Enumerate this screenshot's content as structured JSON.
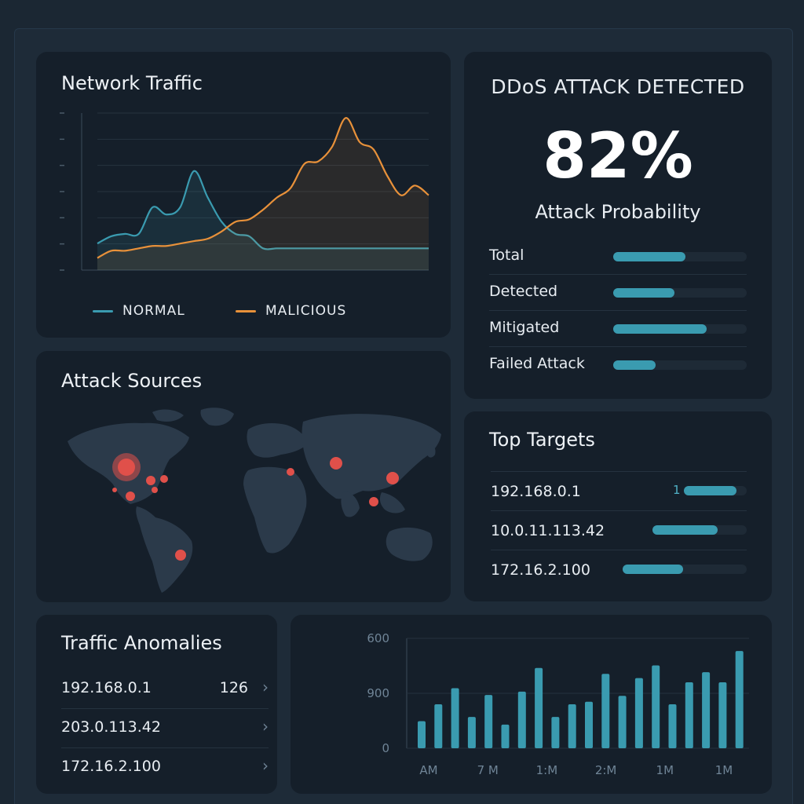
{
  "traffic": {
    "title": "Network Traffic",
    "legend": [
      {
        "label": "NORMAL",
        "color": "#3a9bb0"
      },
      {
        "label": "MALICIOUS",
        "color": "#e8913a"
      }
    ]
  },
  "ddos": {
    "title": "DDoS ATTACK DETECTED",
    "value": "82%",
    "subtitle": "Attack Probability",
    "stats": [
      {
        "label": "Total",
        "fraction": 0.54
      },
      {
        "label": "Detected",
        "fraction": 0.46
      },
      {
        "label": "Mitigated",
        "fraction": 0.7
      },
      {
        "label": "Failed Attack",
        "fraction": 0.32
      }
    ]
  },
  "sources": {
    "title": "Attack Sources"
  },
  "targets": {
    "title": "Top Targets",
    "rows": [
      {
        "label": "192.168.0.1",
        "count": "1",
        "fraction": 0.84
      },
      {
        "label": "10.0.11.113.42",
        "count": "",
        "fraction": 0.69
      },
      {
        "label": "172.16.2.100",
        "count": "",
        "fraction": 0.49
      }
    ]
  },
  "anomalies": {
    "title": "Traffic Anomalies",
    "rows": [
      {
        "label": "192.168.0.1",
        "count": "126"
      },
      {
        "label": "203.0.113.42",
        "count": ""
      },
      {
        "label": "172.16.2.100",
        "count": ""
      }
    ]
  },
  "colors": {
    "accent": "#3a9bb0",
    "malicious": "#e8913a",
    "hotspot": "#e0504a"
  },
  "chart_data": [
    {
      "type": "line",
      "title": "Network Traffic",
      "x": [
        0,
        1,
        2,
        3,
        4,
        5,
        6,
        7,
        8,
        9,
        10,
        11,
        12,
        13,
        14,
        15,
        16,
        17,
        18,
        19,
        20,
        21,
        22,
        23,
        24
      ],
      "series": [
        {
          "name": "NORMAL",
          "values": [
            1.1,
            1.4,
            1.5,
            1.5,
            2.6,
            2.3,
            2.6,
            4.1,
            3.0,
            2.0,
            1.5,
            1.4,
            0.9,
            0.9,
            0.9,
            0.9,
            0.9,
            0.9,
            0.9,
            0.9,
            0.9,
            0.9,
            0.9,
            0.9,
            0.9
          ]
        },
        {
          "name": "MALICIOUS",
          "values": [
            0.5,
            0.8,
            0.8,
            0.9,
            1.0,
            1.0,
            1.1,
            1.2,
            1.3,
            1.6,
            2.0,
            2.1,
            2.5,
            3.0,
            3.4,
            4.4,
            4.5,
            5.1,
            6.3,
            5.3,
            5.0,
            3.9,
            3.1,
            3.5,
            3.1
          ]
        }
      ],
      "ylim": [
        0,
        6.5
      ],
      "grid": true,
      "legend": "bottom"
    },
    {
      "type": "bar",
      "ylabel": "",
      "yticks": [
        "0",
        "900",
        "600"
      ],
      "xticks": [
        "AM",
        "7 M",
        "1:M",
        "2:M",
        "1M",
        "1M"
      ],
      "values": [
        32,
        52,
        71,
        37,
        63,
        28,
        67,
        95,
        37,
        52,
        55,
        88,
        62,
        83,
        98,
        52,
        78,
        90,
        78,
        115
      ],
      "ylim": [
        0,
        130
      ],
      "grid": true
    }
  ]
}
